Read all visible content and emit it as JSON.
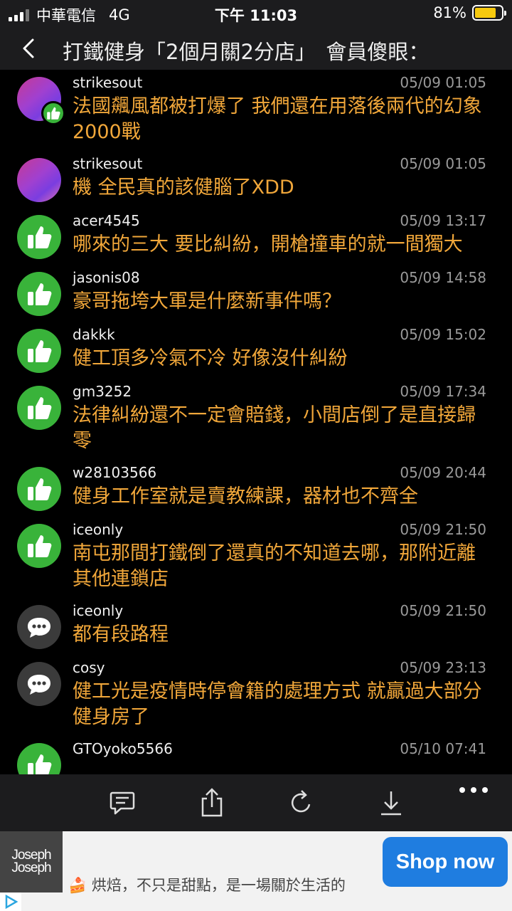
{
  "status_bar": {
    "carrier": "中華電信",
    "network": "4G",
    "time": "下午 11:03",
    "battery_percent": "81%",
    "battery_level": 0.81
  },
  "nav": {
    "title": "打鐵健身「2個月關2分店」　會員傻眼："
  },
  "comments": [
    {
      "avatar": "photo",
      "badge": "like",
      "user": "strikesout",
      "time": "05/09 01:05",
      "text": "法國飆風都被打爆了 我們還在用落後兩代的幻象 2000戰"
    },
    {
      "avatar": "photo",
      "user": "strikesout",
      "time": "05/09 01:05",
      "text": "機 全民真的該健腦了XDD"
    },
    {
      "avatar": "like",
      "user": "acer4545",
      "time": "05/09 13:17",
      "text": "哪來的三大  要比糾紛，開槍撞車的就一間獨大"
    },
    {
      "avatar": "like",
      "user": "jasonis08",
      "time": "05/09 14:58",
      "text": "豪哥拖垮大軍是什麼新事件嗎？"
    },
    {
      "avatar": "like",
      "user": "dakkk",
      "time": "05/09 15:02",
      "text": "健工頂多冷氣不冷 好像沒什糾紛"
    },
    {
      "avatar": "like",
      "user": "gm3252",
      "time": "05/09 17:34",
      "text": "法律糾紛還不一定會賠錢，小間店倒了是直接歸零"
    },
    {
      "avatar": "like",
      "user": "w28103566",
      "time": "05/09 20:44",
      "text": "健身工作室就是賣教練課，器材也不齊全"
    },
    {
      "avatar": "like",
      "user": "iceonly",
      "time": "05/09 21:50",
      "text": "南屯那間打鐵倒了還真的不知道去哪，那附近離其他連鎖店"
    },
    {
      "avatar": "chat",
      "user": "iceonly",
      "time": "05/09 21:50",
      "text": "都有段路程"
    },
    {
      "avatar": "chat",
      "user": "cosy",
      "time": "05/09 23:13",
      "text": "健工光是疫情時停會籍的處理方式 就贏過大部分健身房了"
    },
    {
      "avatar": "like",
      "user": "GTOyoko5566",
      "time": "05/10 07:41",
      "text": ""
    }
  ],
  "toolbar": {
    "icons": [
      "comment-icon",
      "share-icon",
      "refresh-icon",
      "download-icon",
      "more-icon"
    ]
  },
  "ad": {
    "logo_line1": "Joseph",
    "logo_line2": "Joseph",
    "text": "🍰 烘焙，不只是甜點，是一場關於生活的",
    "button": "Shop now"
  },
  "colors": {
    "comment_text": "#f1a73a",
    "like_green": "#39b33a",
    "bar_bg": "#1c1c1e",
    "ad_button": "#1f7de0"
  }
}
